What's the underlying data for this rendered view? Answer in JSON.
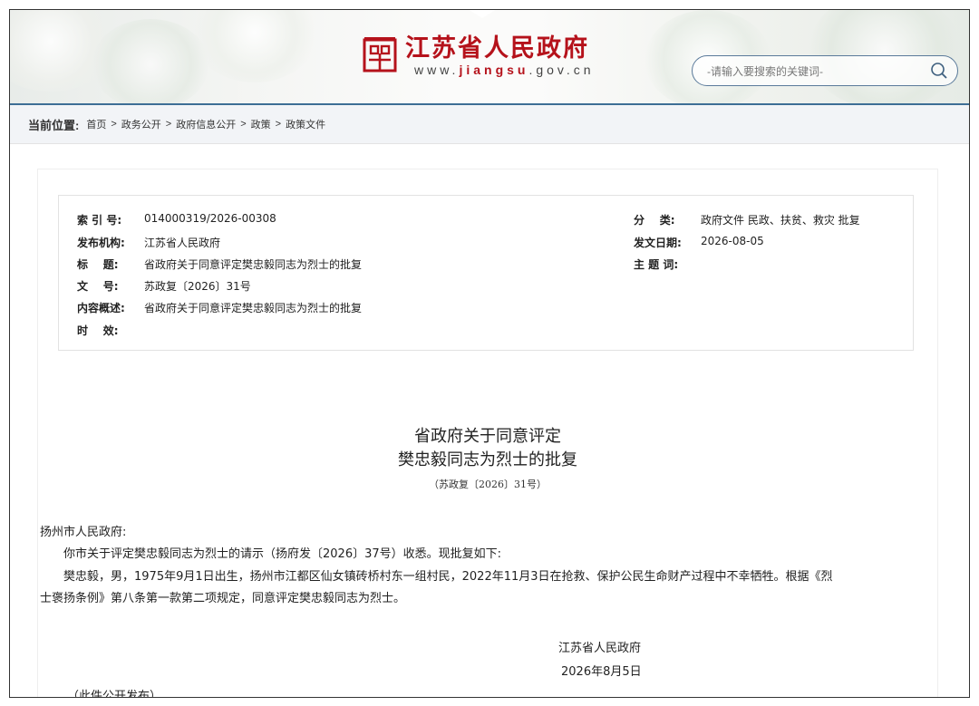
{
  "header": {
    "site_title": "江苏省人民政府",
    "url_prefix": "www.",
    "url_highlight": "jiangsu",
    "url_suffix": ".gov.cn",
    "search_placeholder": "-请输入要搜索的关键词-",
    "brand_color": "#b5121b",
    "accent_color": "#3d6e95"
  },
  "breadcrumb": {
    "label": "当前位置:",
    "items": [
      "首页",
      "政务公开",
      "政府信息公开",
      "政策",
      "政策文件"
    ],
    "separator": ">"
  },
  "meta": {
    "index_label": "索 引 号:",
    "index_value": "014000319/2026-00308",
    "publisher_label": "发布机构:",
    "publisher_value": "江苏省人民政府",
    "title_label": "标    题:",
    "title_value": "省政府关于同意评定樊忠毅同志为烈士的批复",
    "docno_label": "文    号:",
    "docno_value": "苏政复〔2026〕31号",
    "summary_label": "内容概述:",
    "summary_value": "省政府关于同意评定樊忠毅同志为烈士的批复",
    "validity_label": "时    效:",
    "validity_value": "",
    "category_label": "分    类:",
    "category_value": "政府文件 民政、扶贫、救灾 批复",
    "date_label": "发文日期:",
    "date_value": "2026-08-05",
    "subject_label": "主 题 词:",
    "subject_value": ""
  },
  "document": {
    "title_line1": "省政府关于同意评定",
    "title_line2": "樊忠毅同志为烈士的批复",
    "doc_number": "（苏政复〔2026〕31号）",
    "recipient": "扬州市人民政府:",
    "para1": "你市关于评定樊忠毅同志为烈士的请示（扬府发〔2026〕37号）收悉。现批复如下:",
    "para2_line1": "樊忠毅，男，1975年9月1日出生，扬州市江都区仙女镇砖桥村东一组村民，2022年11月3日在抢救、保护公民生命财产过程中不幸牺牲。根据《烈",
    "para2_line2": "士褒扬条例》第八条第一款第二项规定，同意评定樊忠毅同志为烈士。",
    "signatory": "江苏省人民政府",
    "sign_date": "2026年8月5日",
    "publish_note": "（此件公开发布）"
  }
}
